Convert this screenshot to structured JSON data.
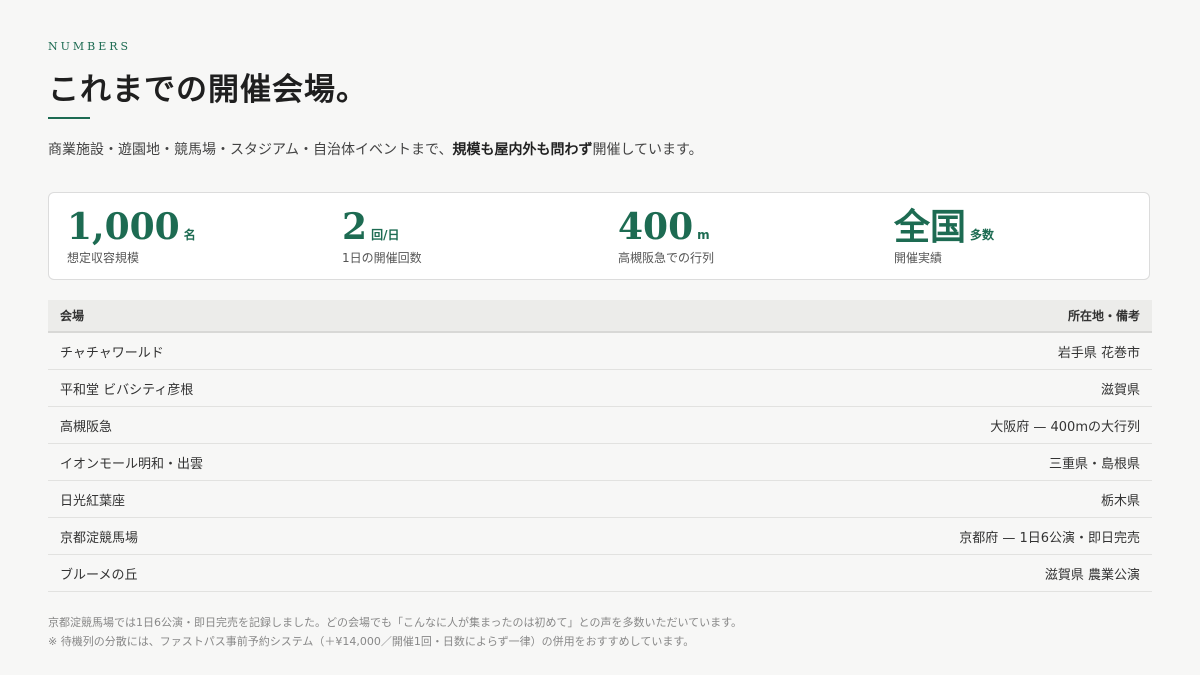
{
  "header": {
    "kicker": "NUMBERS",
    "title": "これまでの開催会場。"
  },
  "lead": {
    "before": "商業施設・遊園地・競馬場・スタジアム・自治体イベントまで、",
    "emphasis": "規模も屋内外も問わず",
    "after": "開催しています。"
  },
  "stats": [
    {
      "value": "1,000",
      "unit": "名",
      "label": "想定収容規模"
    },
    {
      "value": "2",
      "unit": "回/日",
      "label": "1日の開催回数"
    },
    {
      "value": "400",
      "unit": "m",
      "label": "高槻阪急での行列"
    },
    {
      "value": "全国",
      "unit": "多数",
      "label": "開催実績"
    }
  ],
  "table": {
    "headers": [
      "会場",
      "所在地・備考"
    ],
    "rows": [
      {
        "venue": "チャチャワールド",
        "note": "岩手県 花巻市"
      },
      {
        "venue": "平和堂 ビバシティ彦根",
        "note": "滋賀県"
      },
      {
        "venue": "高槻阪急",
        "note": "大阪府 — 400mの大行列"
      },
      {
        "venue": "イオンモール明和・出雲",
        "note": "三重県・島根県"
      },
      {
        "venue": "日光紅葉座",
        "note": "栃木県"
      },
      {
        "venue": "京都淀競馬場",
        "note": "京都府 — 1日6公演・即日完売"
      },
      {
        "venue": "ブルーメの丘",
        "note": "滋賀県 農業公演"
      }
    ]
  },
  "footnotes": [
    "京都淀競馬場では1日6公演・即日完売を記録しました。どの会場でも「こんなに人が集まったのは初めて」との声を多数いただいています。",
    "※ 待機列の分散には、ファストパス事前予約システム（＋¥14,000／開催1回・日数によらず一律）の併用をおすすめしています。"
  ],
  "colors": {
    "accent": "#1d6b52",
    "background": "#f7f7f6"
  }
}
